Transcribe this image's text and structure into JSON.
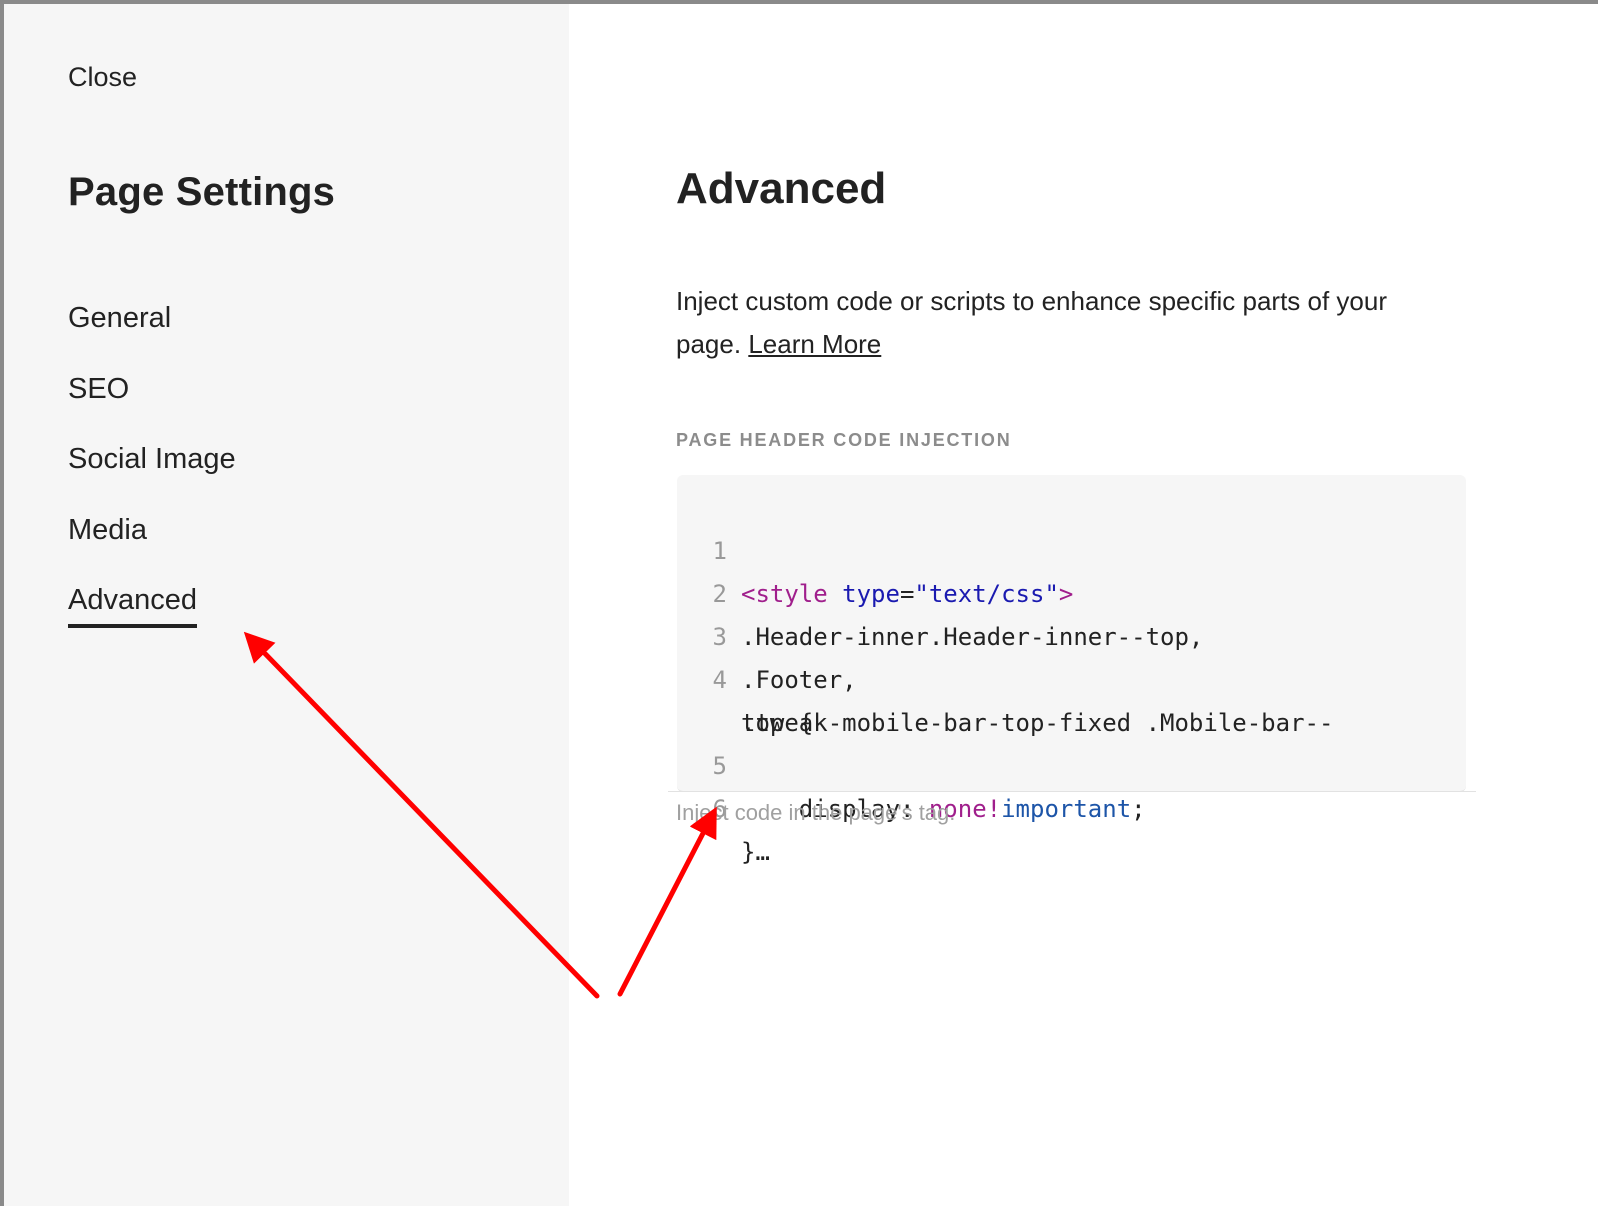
{
  "sidebar": {
    "close_label": "Close",
    "title": "Page Settings",
    "items": [
      {
        "label": "General"
      },
      {
        "label": "SEO"
      },
      {
        "label": "Social Image"
      },
      {
        "label": "Media"
      },
      {
        "label": "Advanced"
      }
    ],
    "active_item": "Advanced"
  },
  "main": {
    "title": "Advanced",
    "description": "Inject custom code or scripts to enhance specific parts of your page.",
    "learn_more_label": "Learn More",
    "section_label": "PAGE HEADER CODE INJECTION",
    "code": {
      "line_numbers": [
        "1",
        "2",
        "3",
        "4",
        "5",
        "6"
      ],
      "line1_open": "<style",
      "line1_attr": "type",
      "line1_eq": "=",
      "line1_str": "\"text/css\"",
      "line1_close": ">",
      "line2": ".Header-inner.Header-inner--top,",
      "line3": ".Footer,",
      "line4a": ".tweak-mobile-bar-top-fixed .Mobile-bar--",
      "line4b": "top {",
      "line5_prop": "    display: ",
      "line5_val": "none",
      "line5_bang": "!",
      "line5_imp": "important",
      "line5_semi": ";",
      "line6": "}…"
    },
    "hint": "Inject code in the page's tag."
  },
  "colors": {
    "sidebar_bg": "#f6f6f6",
    "code_bg": "#f6f6f6",
    "annotation_arrow": "#ff0000",
    "tag_color": "#a01f8c",
    "attr_color": "#1a1ab0"
  }
}
